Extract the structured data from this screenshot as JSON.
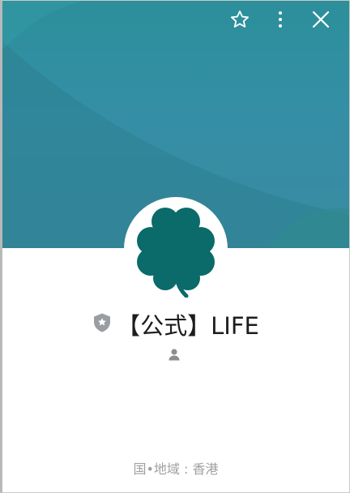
{
  "header": {
    "icons": [
      "star-icon",
      "more-vertical-icon",
      "close-icon"
    ]
  },
  "profile": {
    "avatar_icon": "clover-icon",
    "badge_icon": "official-shield-icon",
    "name": "【公式】LIFE",
    "friends_icon": "person-icon",
    "friend_count": "",
    "region_text": "国•地域 : 香港"
  },
  "colors": {
    "cover_top": "#2c8f9a",
    "cover_bottom": "#3a8aa1",
    "clover": "#0b6a6a",
    "name_text": "#1d1d1d",
    "meta_text": "#a0a0a0"
  }
}
